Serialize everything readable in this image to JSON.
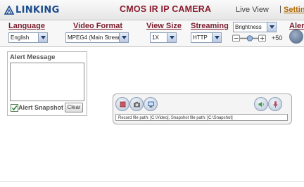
{
  "header": {
    "logo_text": "LINKING",
    "camera_title": "CMOS IR IP CAMERA",
    "live_view": "Live View",
    "separator": "|",
    "setting": "Setting"
  },
  "controls": {
    "language": {
      "label": "Language",
      "value": "English"
    },
    "video_format": {
      "label": "Video Format",
      "value": "MPEG4 (Main Stream)"
    },
    "view_size": {
      "label": "View Size",
      "value": "1X"
    },
    "streaming": {
      "label": "Streaming",
      "value": "HTTP"
    },
    "brightness": {
      "value": "Brightness",
      "level": "+50"
    },
    "alert": {
      "label": "Alert"
    }
  },
  "alert_panel": {
    "title": "Alert Message",
    "snapshot_label": "Alert Snapshot",
    "snapshot_checked": true,
    "clear_label": "Clear"
  },
  "video_toolbar": {
    "buttons": [
      "record-icon",
      "snapshot-icon",
      "settings-icon",
      "speaker-icon",
      "microphone-icon"
    ],
    "path_text": "Record file path: [C:\\Video], Snapshot file path: [C:\\Snapshot]"
  },
  "colors": {
    "brand": "#1a4b8c",
    "title": "#8a1b2d",
    "setting_link": "#b26a00"
  }
}
